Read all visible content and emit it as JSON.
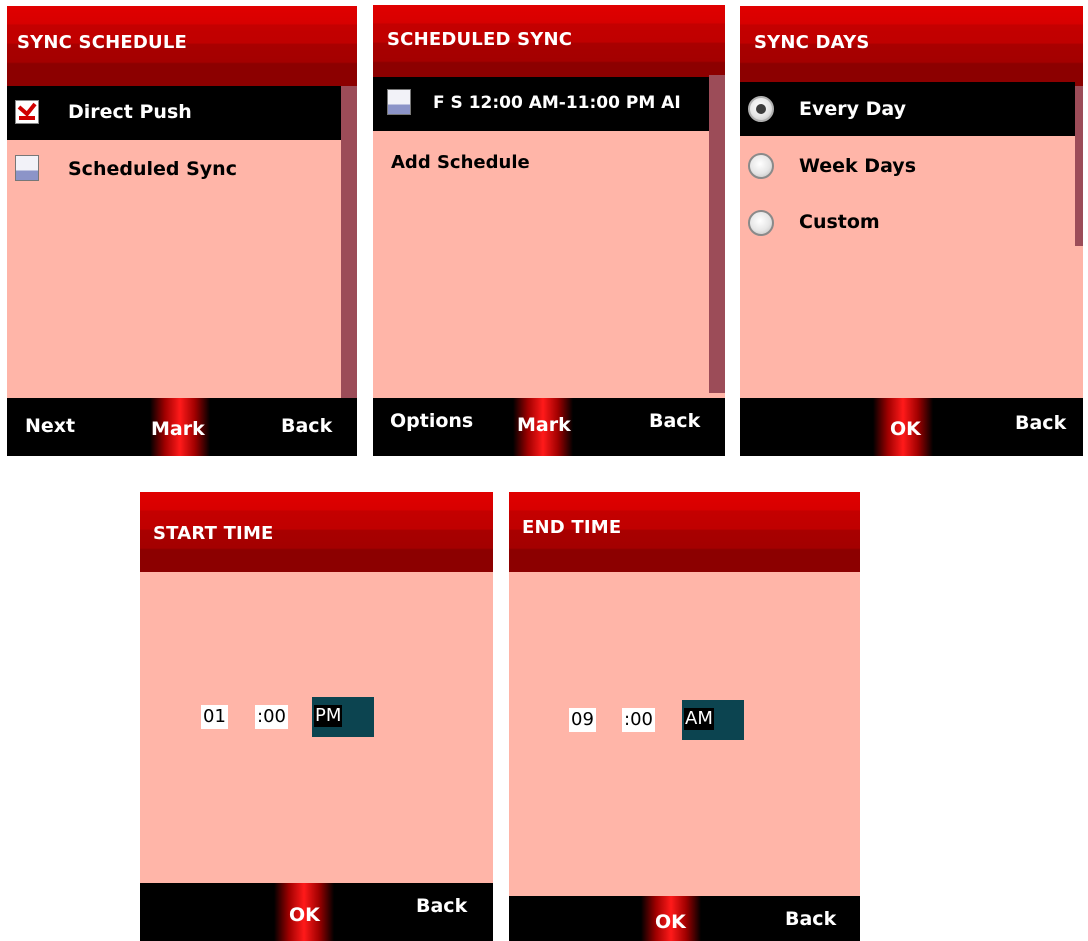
{
  "screens": [
    {
      "title": "SYNC SCHEDULE",
      "items": [
        {
          "label": "Direct Push",
          "icon": "checkbox-checked-icon",
          "selected": true
        },
        {
          "label": "Scheduled Sync",
          "icon": "calendar-icon",
          "selected": false
        }
      ],
      "softkeys": {
        "left": "Next",
        "center": "Mark",
        "right": "Back"
      }
    },
    {
      "title": "SCHEDULED SYNC",
      "items": [
        {
          "label": "F S 12:00 AM-11:00 PM AI",
          "icon": "calendar-icon",
          "selected": true
        },
        {
          "label": "Add Schedule",
          "selected": false
        }
      ],
      "softkeys": {
        "left": "Options",
        "center": "Mark",
        "right": "Back"
      }
    },
    {
      "title": "SYNC DAYS",
      "items": [
        {
          "label": "Every Day",
          "icon": "radio-selected-icon",
          "selected": true
        },
        {
          "label": "Week Days",
          "icon": "radio-icon",
          "selected": false
        },
        {
          "label": "Custom",
          "icon": "radio-icon",
          "selected": false
        }
      ],
      "softkeys": {
        "left": "",
        "center": "OK",
        "right": "Back"
      }
    },
    {
      "title": "START TIME",
      "time": {
        "hour": "01",
        "minute": ":00",
        "ampm": "PM"
      },
      "softkeys": {
        "left": "",
        "center": "OK",
        "right": "Back"
      }
    },
    {
      "title": "END TIME",
      "time": {
        "hour": "09",
        "minute": ":00",
        "ampm": "AM"
      },
      "softkeys": {
        "left": "",
        "center": "OK",
        "right": "Back"
      }
    }
  ],
  "colors": {
    "header_red": "#c00000",
    "body_pink": "#ffb5a8",
    "softkey_bar": "#000000",
    "selection": "#000000",
    "scrollbar": "#9c4c58",
    "ampm_field": "#0c4450"
  }
}
